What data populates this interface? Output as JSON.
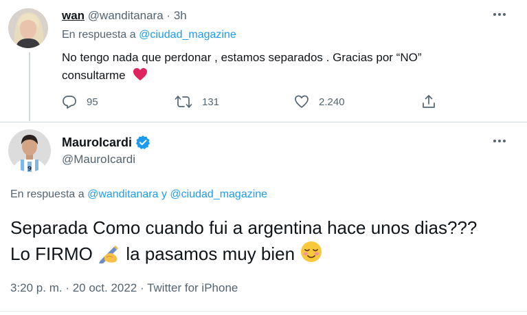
{
  "tweet1": {
    "name": "wan",
    "handle": "@wanditanara",
    "dot": "·",
    "time": "3h",
    "reply_prefix": "En respuesta a",
    "reply_mention": "@ciudad_magazine",
    "text": "No tengo nada que perdonar , estamos separados . Gracias por “NO” consultarme",
    "trailing_emoji": "red-heart-emoji",
    "actions": {
      "reply_count": "95",
      "retweet_count": "131",
      "like_count": "2.240"
    }
  },
  "tweet2": {
    "name": "MauroIcardi",
    "handle": "@MauroIcardi",
    "verified": true,
    "reply_prefix": "En respuesta a",
    "reply_mention_1": "@wanditanara",
    "reply_joiner": "y",
    "reply_mention_2": "@ciudad_magazine",
    "text_1": "Separada Como cuando fui a argentina hace unos dias??? Lo FIRMO",
    "emoji_1": "writing-hand-emoji",
    "text_2": "la pasamos muy bien",
    "emoji_2": "relieved-face-emoji",
    "meta": "3:20 p. m. · 20 oct. 2022 · Twitter for iPhone"
  },
  "colors": {
    "text": "#0f1419",
    "secondary": "#536471",
    "link": "#1d9bf0",
    "divider": "#cfd9de",
    "heart": "#e0245e",
    "verified": "#1d9bf0"
  }
}
